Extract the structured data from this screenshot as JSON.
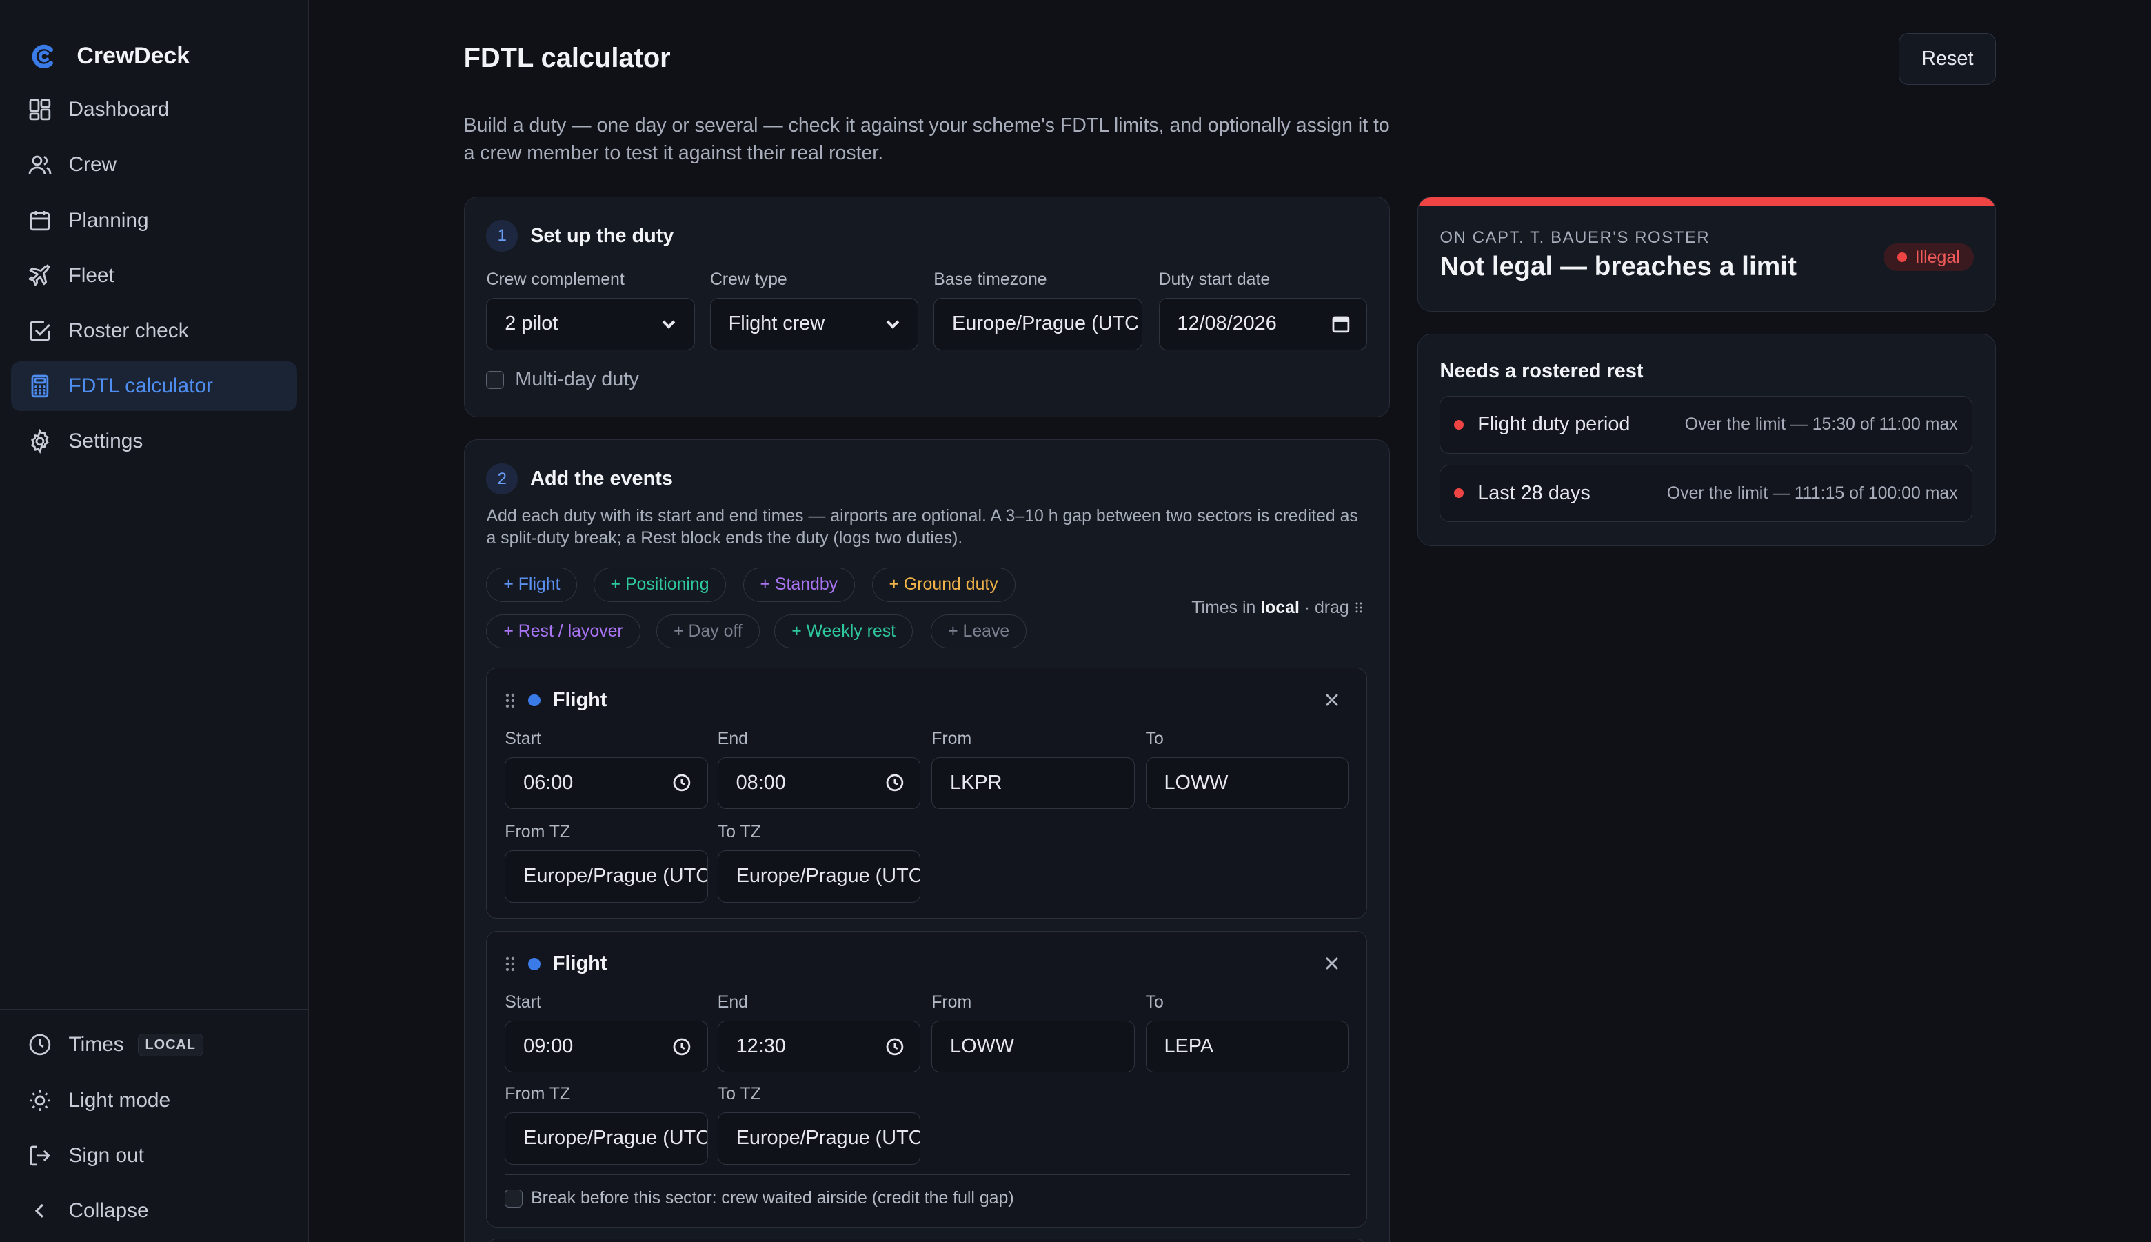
{
  "app": {
    "name": "CrewDeck"
  },
  "sidebar": {
    "items": [
      {
        "label": "Dashboard",
        "icon": "dashboard-icon"
      },
      {
        "label": "Crew",
        "icon": "users-icon"
      },
      {
        "label": "Planning",
        "icon": "calendar-icon"
      },
      {
        "label": "Fleet",
        "icon": "plane-icon"
      },
      {
        "label": "Roster check",
        "icon": "check-square-icon"
      },
      {
        "label": "FDTL calculator",
        "icon": "calculator-icon",
        "active": true
      },
      {
        "label": "Settings",
        "icon": "gear-icon"
      }
    ],
    "bottom": {
      "times_label": "Times",
      "times_badge": "LOCAL",
      "light_mode": "Light mode",
      "sign_out": "Sign out",
      "collapse": "Collapse"
    }
  },
  "page": {
    "title": "FDTL calculator",
    "reset": "Reset",
    "intro": "Build a duty — one day or several — check it against your scheme's FDTL limits, and optionally assign it to a crew member to test it against their real roster."
  },
  "step1": {
    "num": "1",
    "title": "Set up the duty",
    "crew_complement_label": "Crew complement",
    "crew_complement_value": "2 pilot",
    "crew_type_label": "Crew type",
    "crew_type_value": "Flight crew",
    "base_tz_label": "Base timezone",
    "base_tz_value": "Europe/Prague (UTC",
    "start_date_label": "Duty start date",
    "start_date_value": "12/08/2026",
    "multi_day": "Multi-day duty"
  },
  "step2": {
    "num": "2",
    "title": "Add the events",
    "desc": "Add each duty with its start and end times — airports are optional. A 3–10 h gap between two sectors is credited as a split-duty break; a Rest block ends the duty (logs two duties).",
    "chips": {
      "flight": "+ Flight",
      "positioning": "+ Positioning",
      "standby": "+ Standby",
      "ground": "+ Ground duty",
      "rest": "+ Rest / layover",
      "dayoff": "+ Day off",
      "weekly": "+ Weekly rest",
      "leave": "+ Leave"
    },
    "times_note_prefix": "Times in ",
    "times_note_bold": "local",
    "times_note_suffix": " · drag",
    "chip_colors": {
      "flight": "#5b8ff0",
      "positioning": "#2fc7a0",
      "standby": "#a974f2",
      "ground": "#f0b34a",
      "rest": "#a974f2",
      "muted": "#7b8190",
      "weekly": "#2fc7a0"
    },
    "labels": {
      "start": "Start",
      "end": "End",
      "from": "From",
      "to": "To",
      "from_tz": "From TZ",
      "to_tz": "To TZ"
    },
    "events": [
      {
        "type": "Flight",
        "start": "06:00",
        "end": "08:00",
        "from": "LKPR",
        "to": "LOWW",
        "from_tz": "Europe/Prague (UTC",
        "to_tz": "Europe/Prague (UTC"
      },
      {
        "type": "Flight",
        "start": "09:00",
        "end": "12:30",
        "from": "LOWW",
        "to": "LEPA",
        "from_tz": "Europe/Prague (UTC",
        "to_tz": "Europe/Prague (UTC",
        "break_note": "Break before this sector: crew waited airside (credit the full gap)"
      }
    ]
  },
  "verdict": {
    "subtitle": "ON CAPT. T. BAUER'S ROSTER",
    "title": "Not legal — breaches a limit",
    "badge": "Illegal",
    "accent": "#ef4444"
  },
  "rest": {
    "title": "Needs a rostered rest",
    "limits": [
      {
        "name": "Flight duty period",
        "detail": "Over the limit — 15:30 of 11:00 max"
      },
      {
        "name": "Last 28 days",
        "detail": "Over the limit — 111:15 of 100:00 max"
      }
    ]
  }
}
